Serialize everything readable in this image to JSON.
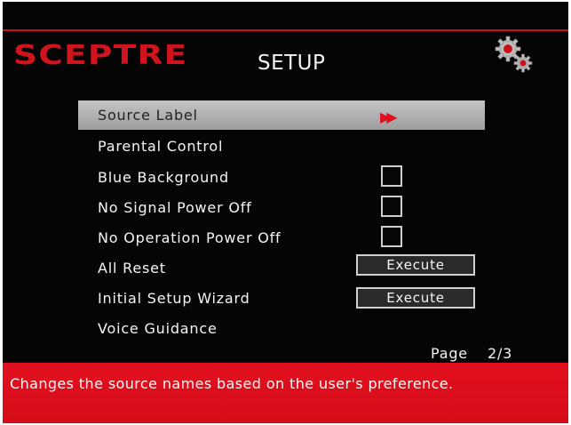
{
  "brand": {
    "logo_text": "SCEPTRE",
    "accent_color": "#d0141e"
  },
  "header": {
    "title": "SETUP",
    "icon": "gears-icon"
  },
  "menu": {
    "items": [
      {
        "label": "Source Label",
        "selected": true,
        "control": "submenu-arrow",
        "arrow": "▶▶"
      },
      {
        "label": "Parental Control",
        "selected": false,
        "control": "none"
      },
      {
        "label": "Blue Background",
        "selected": false,
        "control": "checkbox",
        "checked": false
      },
      {
        "label": "No Signal Power Off",
        "selected": false,
        "control": "checkbox",
        "checked": false
      },
      {
        "label": "No Operation Power Off",
        "selected": false,
        "control": "checkbox",
        "checked": false
      },
      {
        "label": "All Reset",
        "selected": false,
        "control": "button",
        "button_label": "Execute"
      },
      {
        "label": "Initial Setup Wizard",
        "selected": false,
        "control": "button",
        "button_label": "Execute"
      },
      {
        "label": "Voice Guidance",
        "selected": false,
        "control": "none"
      }
    ]
  },
  "pagination": {
    "label": "Page",
    "value": "2/3"
  },
  "help": {
    "text": "Changes the source names based on the user's preference."
  }
}
